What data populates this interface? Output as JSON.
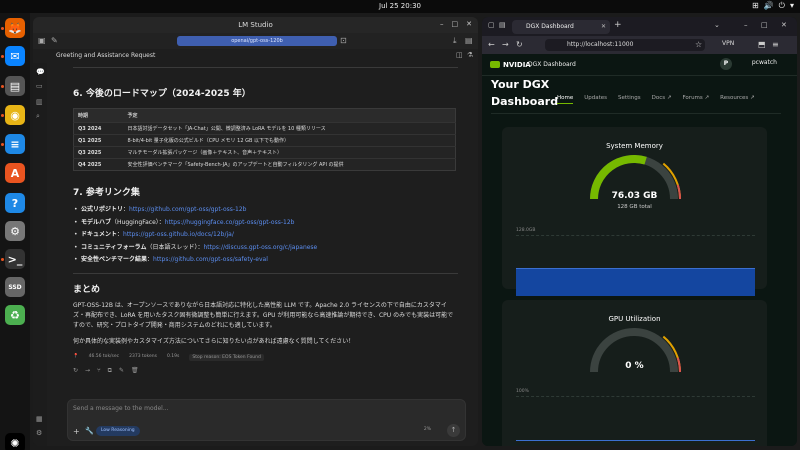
{
  "topbar": {
    "clock": "Jul 25  20:30",
    "tray": [
      "⊞",
      "🔊",
      "⏻",
      "▾"
    ]
  },
  "dock": {
    "items": [
      {
        "name": "firefox",
        "glyph": "🦊",
        "color": "#e66000"
      },
      {
        "name": "thunderbird",
        "glyph": "✉",
        "color": "#0a84ff"
      },
      {
        "name": "files",
        "glyph": "▤",
        "color": "#555"
      },
      {
        "name": "rhythmbox",
        "glyph": "◉",
        "color": "#e7b416"
      },
      {
        "name": "libreoffice-writer",
        "glyph": "≡",
        "color": "#1e88e5"
      },
      {
        "name": "app-center",
        "glyph": "A",
        "color": "#e95420"
      },
      {
        "name": "help",
        "glyph": "?",
        "color": "#1e88e5"
      },
      {
        "name": "settings",
        "glyph": "⚙",
        "color": "#777"
      },
      {
        "name": "terminal",
        "glyph": ">_",
        "color": "#333"
      },
      {
        "name": "disk",
        "glyph": "SSD",
        "color": "#666"
      },
      {
        "name": "trash",
        "glyph": "♻",
        "color": "#4caf50"
      },
      {
        "name": "ubuntu-apps",
        "glyph": "✺",
        "color": "#000"
      }
    ]
  },
  "lm": {
    "window_title": "LM Studio",
    "model_pill": "openai/gpt-oss-120b",
    "chat_title": "Greeting and Assistance Request",
    "roadmap": {
      "heading": "6. 今後のロードマップ（2024-2025 年）",
      "headers": [
        "時期",
        "予定"
      ],
      "rows": [
        [
          "Q3 2024",
          "日本語対話データセット「JA-Chat」公開、微調整済み LoRA モデルを 10 種類リリース"
        ],
        [
          "Q1 2025",
          "8-bit/4-bit 量子化版の公式ビルド（CPU メモリ 12 GB 以下でも動作）"
        ],
        [
          "Q3 2025",
          "マルチモーダル拡張パッケージ（画像＋テキスト、音声＋テキスト）"
        ],
        [
          "Q4 2025",
          "安全性評価ベンチマーク「Safety-Bench-JA」のアップデートと自動フィルタリング API の提供"
        ]
      ]
    },
    "links": {
      "heading": "7. 参考リンク集",
      "items": [
        {
          "label": "公式リポジトリ",
          "sep": "：",
          "url": "https://github.com/gpt-oss/gpt-oss-12b"
        },
        {
          "label": "モデルハブ",
          "sep": "（HuggingFace）：",
          "url": "https://huggingface.co/gpt-oss/gpt-oss-12b"
        },
        {
          "label": "ドキュメント",
          "sep": "：",
          "url": "https://gpt-oss.github.io/docs/12b/ja/"
        },
        {
          "label": "コミュニティフォーラム",
          "sep": "（日本語スレッド）：",
          "url": "https://discuss.gpt-oss.org/c/japanese"
        },
        {
          "label": "安全性ベンチマーク結果",
          "sep": "：",
          "url": "https://github.com/gpt-oss/safety-eval"
        }
      ]
    },
    "summary": {
      "heading": "まとめ",
      "para1": "GPT-OSS-12B は、オープンソースでありながら日本語対応に特化した高性能 LLM です。Apache 2.0 ライセンスの下で自由にカスタマイズ・再配布でき、LoRA を用いたタスク固有微調整も簡単に行えます。GPU が利用可能なら高速推論が期待でき、CPU のみでも実装は可能ですので、研究・プロトタイプ開発・商用システムのどれにも適しています。",
      "para2": "何か具体的な実装例やカスタマイズ方法についてさらに知りたい点があれば遠慮なく質問してください！"
    },
    "stats": {
      "speed": "46.56 tok/sec",
      "tokens": "2373 tokens",
      "time": "0.19s",
      "stop_reason": "Stop reason: EOS Token Found"
    },
    "input": {
      "placeholder": "Send a message to the model...",
      "reasoning": "Low Reasoning",
      "context": "2%"
    }
  },
  "ff": {
    "tab_title": "DGX Dashboard",
    "url": "http://localhost:11000",
    "vpn": "VPN"
  },
  "dgx": {
    "brand": "NVIDIA",
    "header_title": "DGX Dashboard",
    "user_initial": "P",
    "user_name": "pcwatch",
    "title_line1": "Your DGX",
    "title_line2": "Dashboard",
    "nav": [
      "Home",
      "Updates",
      "Settings",
      "Docs ↗",
      "Forums ↗",
      "Resources ↗"
    ],
    "memory": {
      "title": "System Memory",
      "value": "76.03 GB",
      "total": "128 GB total",
      "fraction": 0.594,
      "plot_label": "128.0GB"
    },
    "gpu": {
      "title": "GPU Utilization",
      "value": "0 %",
      "fraction": 0.0,
      "plot_label": "100%"
    },
    "colors": {
      "accent": "#76b900",
      "plot_fill": "#1446a0"
    }
  }
}
